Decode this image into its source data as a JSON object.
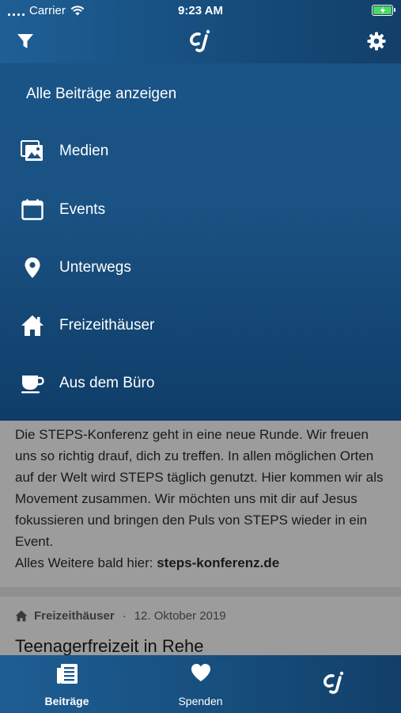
{
  "status_bar": {
    "carrier": "Carrier",
    "time": "9:23 AM"
  },
  "navbar": {
    "filter_icon": "filter-icon",
    "logo_text": "cj",
    "settings_icon": "gear-icon"
  },
  "filter_menu": {
    "show_all": "Alle Beiträge anzeigen",
    "items": [
      {
        "label": "Medien",
        "icon": "photos-icon"
      },
      {
        "label": "Events",
        "icon": "calendar-icon"
      },
      {
        "label": "Unterwegs",
        "icon": "location-pin-icon"
      },
      {
        "label": "Freizeithäuser",
        "icon": "house-icon"
      },
      {
        "label": "Aus dem Büro",
        "icon": "coffee-cup-icon"
      }
    ]
  },
  "feed": {
    "post_text": "Die STEPS-Konferenz geht in eine neue Runde. Wir freuen uns so richtig drauf, dich zu treffen. In allen möglichen Orten auf der Welt wird STEPS täglich genutzt. Hier kommen wir als Movement zusammen. Wir möchten uns mit dir auf Jesus fokussieren und bringen den Puls von STEPS wieder in ein Event.",
    "post_more_prefix": "Alles Weitere bald hier: ",
    "post_link": "steps-konferenz.de",
    "card": {
      "category": "Freizeithäuser",
      "separator": "·",
      "date": "12. Oktober 2019",
      "title": "Teenagerfreizeit in Rehe"
    }
  },
  "tabbar": {
    "tabs": [
      {
        "label": "Beiträge",
        "icon": "articles-icon"
      },
      {
        "label": "Spenden",
        "icon": "heart-icon"
      },
      {
        "label": "",
        "icon": "cj-logo-icon"
      }
    ]
  }
}
